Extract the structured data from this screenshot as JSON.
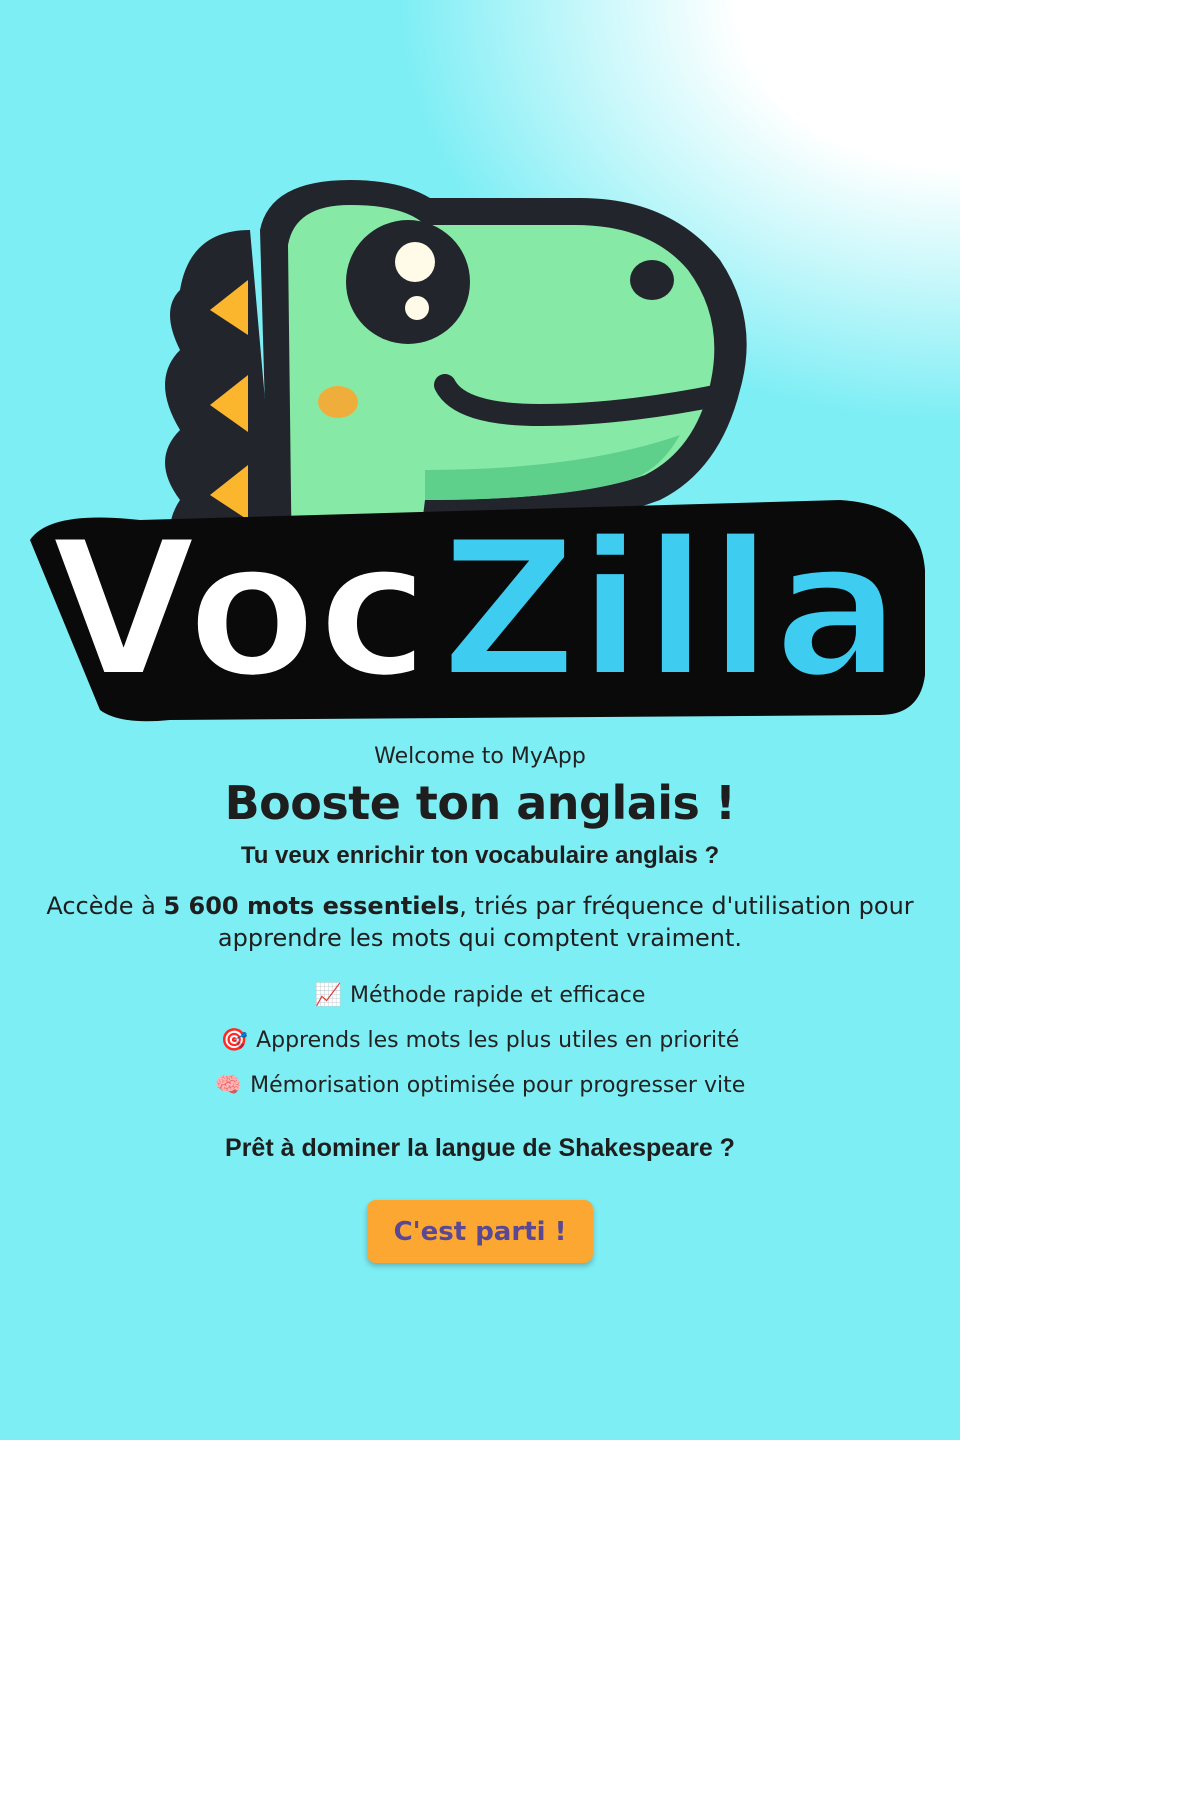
{
  "logo": {
    "text_part1": "Voc",
    "text_part2": "Zilla",
    "mascot": "green-dinosaur-mascot",
    "colors": {
      "dino_green": "#86eaa6",
      "outline": "#22252c",
      "spikes": "#fbb62e",
      "text_white": "#ffffff",
      "text_blue": "#3ecdf0"
    }
  },
  "welcome": "Welcome to MyApp",
  "headline": "Booste ton anglais !",
  "subheadline": "Tu veux enrichir ton vocabulaire anglais ?",
  "description": {
    "prefix": "Accède à ",
    "highlight": "5 600 mots essentiels",
    "suffix": ", triés par fréquence d'utilisation pour apprendre les mots qui comptent vraiment."
  },
  "features": [
    {
      "icon": "chart-increasing-icon",
      "emoji": "📈",
      "text": "Méthode rapide et efficace"
    },
    {
      "icon": "target-icon",
      "emoji": "🎯",
      "text": "Apprends les mots les plus utiles en priorité"
    },
    {
      "icon": "brain-icon",
      "emoji": "🧠",
      "text": "Mémorisation optimisée pour progresser vite"
    }
  ],
  "cta_question": "Prêt à dominer la langue de Shakespeare ?",
  "cta_button": "C'est parti !",
  "colors": {
    "background": "#7eeef5",
    "button_bg": "#fba731",
    "button_text": "#5b4894"
  }
}
